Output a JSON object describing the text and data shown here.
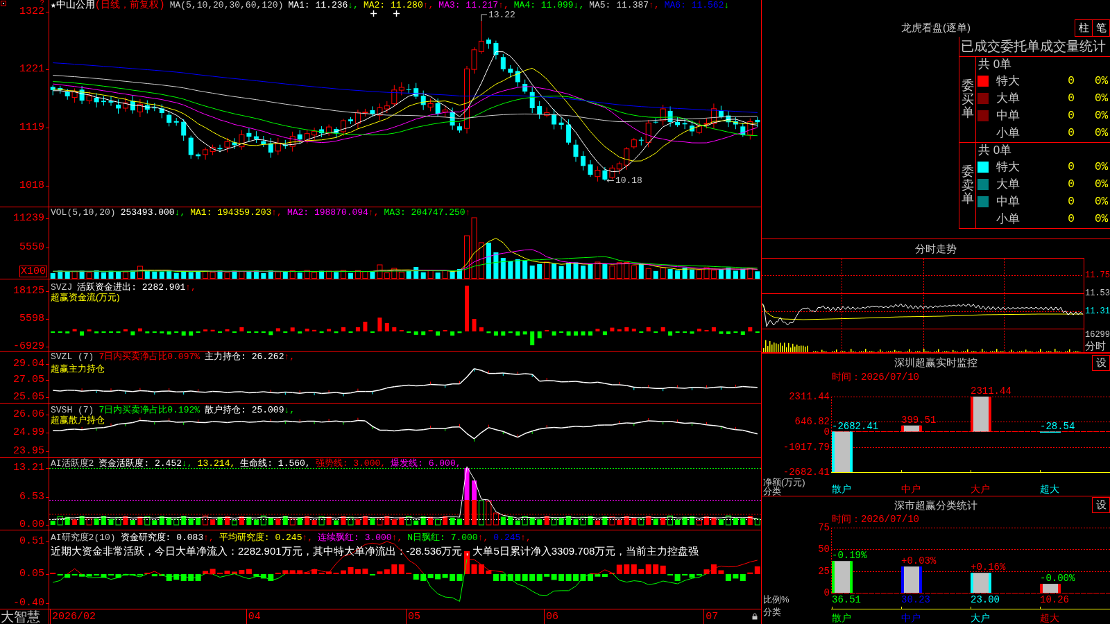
{
  "main_chart": {
    "star": "★",
    "stock": "中山公用",
    "mode": "(日线，前复权)",
    "indicator": "MA(5,10,20,30,60,120)",
    "legend": [
      {
        "text": "MA1: 11.236",
        "arrow": "↓,",
        "rising": false,
        "color": "#ffffff"
      },
      {
        "text": "MA2: 11.280",
        "arrow": "↑,",
        "rising": true,
        "color": "#ffff00"
      },
      {
        "text": "MA3: 11.217",
        "arrow": "↑,",
        "rising": true,
        "color": "#ff00ff"
      },
      {
        "text": "MA4: 11.099",
        "arrow": "↓,",
        "rising": false,
        "color": "#00ff00"
      },
      {
        "text": "MA5: 11.387",
        "arrow": "↑,",
        "rising": true,
        "color": "#d0d0d0"
      },
      {
        "text": "MA6: 11.562",
        "arrow": "↓",
        "rising": false,
        "color": "#0000ff"
      }
    ],
    "yticks": [
      "1322",
      "1221",
      "1119",
      "1018"
    ],
    "help": "?",
    "high_label": "13.22",
    "low_label": "10.18"
  },
  "volume": {
    "indicator": "VOL(5,10,20)",
    "legend": [
      {
        "text": "253493.000",
        "arrow": "↓,",
        "rising": false,
        "color": "#ffffff"
      },
      {
        "text": "MA1: 194359.203",
        "arrow": "↑,",
        "rising": true,
        "color": "#ffff00"
      },
      {
        "text": "MA2: 198870.094",
        "arrow": "↑,",
        "rising": true,
        "color": "#ff00ff"
      },
      {
        "text": "MA3: 204747.250",
        "arrow": "↑",
        "rising": true,
        "color": "#00ff00"
      }
    ],
    "yticks": [
      "11239",
      "5550"
    ],
    "unit": "X100"
  },
  "fund_flow": {
    "indicator": "SVZJ",
    "legend": [
      {
        "text": "活跃资金进出: 2282.901",
        "arrow": "↑,",
        "rising": true,
        "color": "#ffffff"
      }
    ],
    "subtitle": "超赢资金流(万元)",
    "yticks": [
      "18125",
      "5598",
      "-6929"
    ]
  },
  "main_holding": {
    "indicator": "SVZL (7)",
    "legend": [
      {
        "text": "7日内买卖净占比0.097%",
        "color": "#ff0000"
      },
      {
        "text": "主力持仓: 26.262",
        "arrow": "↑,",
        "rising": true,
        "color": "#ffffff"
      }
    ],
    "subtitle": "超赢主力持仓",
    "yticks": [
      "29.04",
      "27.05",
      "25.05"
    ]
  },
  "retail_holding": {
    "indicator": "SVSH (7)",
    "legend": [
      {
        "text": "7日内买卖净占比0.192%",
        "color": "#00ff00"
      },
      {
        "text": "散户持仓: 25.009",
        "arrow": "↓,",
        "rising": false,
        "color": "#ffffff"
      }
    ],
    "subtitle": "超赢散户持仓",
    "yticks": [
      "26.06",
      "24.99",
      "23.95"
    ]
  },
  "activity": {
    "indicator": "AI活跃度2",
    "legend": [
      {
        "text": "资金活跃度: 2.452",
        "arrow": "↓,",
        "rising": false,
        "color": "#ffffff"
      },
      {
        "text": "13.214,",
        "color": "#ffff00"
      },
      {
        "text": "生命线: 1.560,",
        "color": "#ffffff"
      },
      {
        "text": "强势线: 3.000,",
        "color": "#ff0000"
      },
      {
        "text": "爆发线: 6.000,",
        "color": "#ff00ff"
      }
    ],
    "yticks": [
      "13.21",
      "6.53",
      "0.00"
    ]
  },
  "research": {
    "indicator": "AI研究度2(10)",
    "legend": [
      {
        "text": "资金研究度: 0.083",
        "arrow": "↑,",
        "rising": true,
        "color": "#ffffff"
      },
      {
        "text": "平均研究度: 0.245",
        "arrow": "↑,",
        "rising": true,
        "color": "#ffff00"
      },
      {
        "text": "连续飘红: 3.000",
        "arrow": "↑,",
        "rising": true,
        "color": "#ff00ff"
      },
      {
        "text": "N日飘红: 7.000",
        "arrow": "↑,",
        "rising": true,
        "color": "#00ff00"
      },
      {
        "text": "0.245",
        "arrow": "↑,",
        "rising": true,
        "color": "#0000ff"
      }
    ],
    "note": "近期大资金非常活跃，今日大单净流入：2282.901万元，其中特大单净流出：-28.536万元，大单5日累计净入3309.708万元，当前主力控盘强",
    "yticks": [
      "0.51",
      "0.05",
      "-0.40"
    ]
  },
  "time_axis": {
    "brand": "大智慧",
    "dates": [
      "2026/02",
      "04",
      "05",
      "06",
      "07"
    ]
  },
  "order_stats": {
    "title": "龙虎看盘(逐单)",
    "buttons": [
      {
        "label": "柱"
      },
      {
        "label": "笔"
      }
    ],
    "heading": "已成交委托单成交量统计",
    "groups": [
      {
        "label": "委买单",
        "total": "共 0单",
        "rows": [
          {
            "label": "特大",
            "count": "0",
            "share": "0%",
            "color": "#ff0000"
          },
          {
            "label": "大单",
            "count": "0",
            "share": "0%",
            "color": "#800000"
          },
          {
            "label": "中单",
            "count": "0",
            "share": "0%",
            "color": "#800000"
          },
          {
            "label": "小单",
            "count": "0",
            "share": "0%"
          }
        ]
      },
      {
        "label": "委卖单",
        "total": "共 0单",
        "rows": [
          {
            "label": "特大",
            "count": "0",
            "share": "0%",
            "color": "#00ffff"
          },
          {
            "label": "大单",
            "count": "0",
            "share": "0%",
            "color": "#008080"
          },
          {
            "label": "中单",
            "count": "0",
            "share": "0%",
            "color": "#008080"
          },
          {
            "label": "小单",
            "count": "0",
            "share": "0%"
          }
        ]
      }
    ]
  },
  "intraday": {
    "title": "分时走势",
    "price_ticks": [
      {
        "text": "11.75",
        "color": "#ff0000"
      },
      {
        "text": "11.53",
        "color": "#c8c8c8"
      },
      {
        "text": "11.31",
        "color": "#00ffff"
      }
    ],
    "volume_tick": "16299",
    "label": "分时"
  },
  "sz_monitor": {
    "settings": "设",
    "time": "时间：2026/07/10",
    "chart_data": {
      "type": "bar",
      "title": "深圳超赢实时监控",
      "xlabel": "分类",
      "ylabel": "净额(万元)",
      "categories": [
        "散户",
        "中户",
        "大户",
        "超大"
      ],
      "values": [
        -2682.41,
        399.51,
        2311.44,
        -28.54
      ],
      "ylim": [
        -2682.41,
        2311.44
      ],
      "yticks": [
        {
          "value": 2311.44,
          "label": "2311.44"
        },
        {
          "value": 646.82,
          "label": "646.82"
        },
        {
          "value": 0,
          "label": "0"
        },
        {
          "value": -1017.79,
          "label": "-1017.79"
        },
        {
          "value": -2682.41,
          "label": "-2682.41"
        }
      ],
      "grid": true,
      "value_labels": [
        "-2682.41",
        "399.51",
        "2311.44",
        "-28.54"
      ]
    }
  },
  "sz_stats": {
    "settings": "设",
    "time": "时间：2026/07/10",
    "bars": [
      {
        "color": "#00ff00",
        "change": "-0.19%",
        "rising": false
      },
      {
        "color": "#0000ff",
        "change": "+0.03%",
        "rising": true
      },
      {
        "color": "#00ffff",
        "change": "+0.16%",
        "rising": true
      },
      {
        "color": "#ff0000",
        "change": "-0.00%",
        "rising": false
      }
    ],
    "chart_data": {
      "type": "bar",
      "title": "深市超赢分类统计",
      "xlabel": "分类",
      "ylabel": "比例%",
      "categories": [
        "散户",
        "中户",
        "大户",
        "超大"
      ],
      "values": [
        36.51,
        30.23,
        23.0,
        10.26
      ],
      "ylim": [
        0,
        75
      ],
      "yticks": [
        0,
        25,
        50,
        75
      ],
      "grid": true,
      "value_labels": [
        "36.51",
        "30.23",
        "23.00",
        "10.26"
      ]
    }
  }
}
